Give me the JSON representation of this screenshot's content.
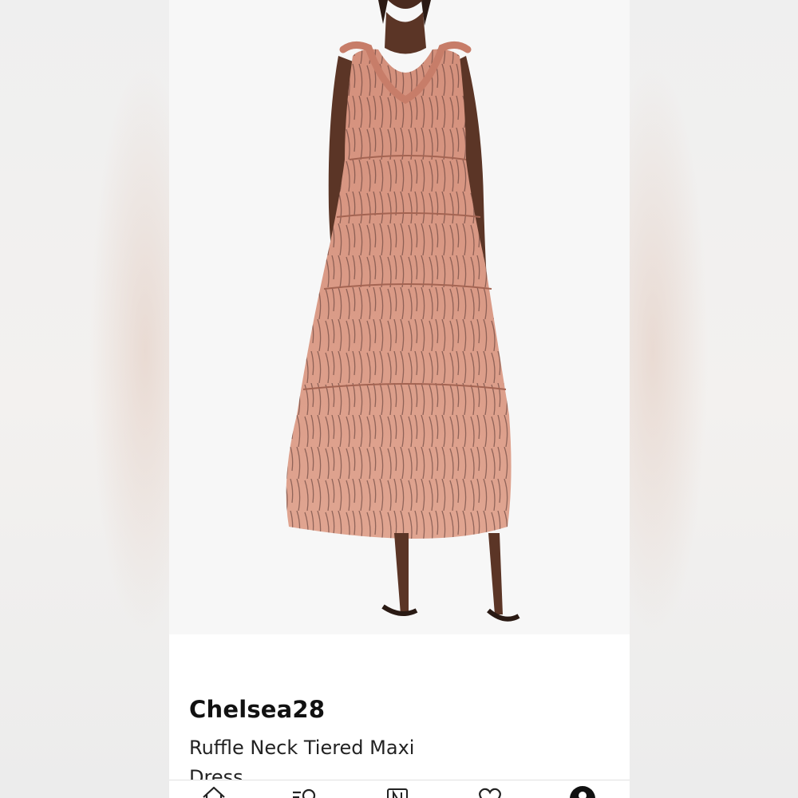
{
  "product": {
    "brand": "Chelsea28",
    "name": "Ruffle Neck Tiered Maxi Dress"
  },
  "tabbar": {
    "items": [
      {
        "icon": "home-icon"
      },
      {
        "icon": "search-list-icon"
      },
      {
        "icon": "nordstrom-n-icon"
      },
      {
        "icon": "heart-icon"
      },
      {
        "icon": "account-icon",
        "active": true
      }
    ]
  },
  "colors": {
    "dress": "#d99580",
    "print": "#5a3a34",
    "skin": "#5b3526",
    "accent": "#111111"
  }
}
